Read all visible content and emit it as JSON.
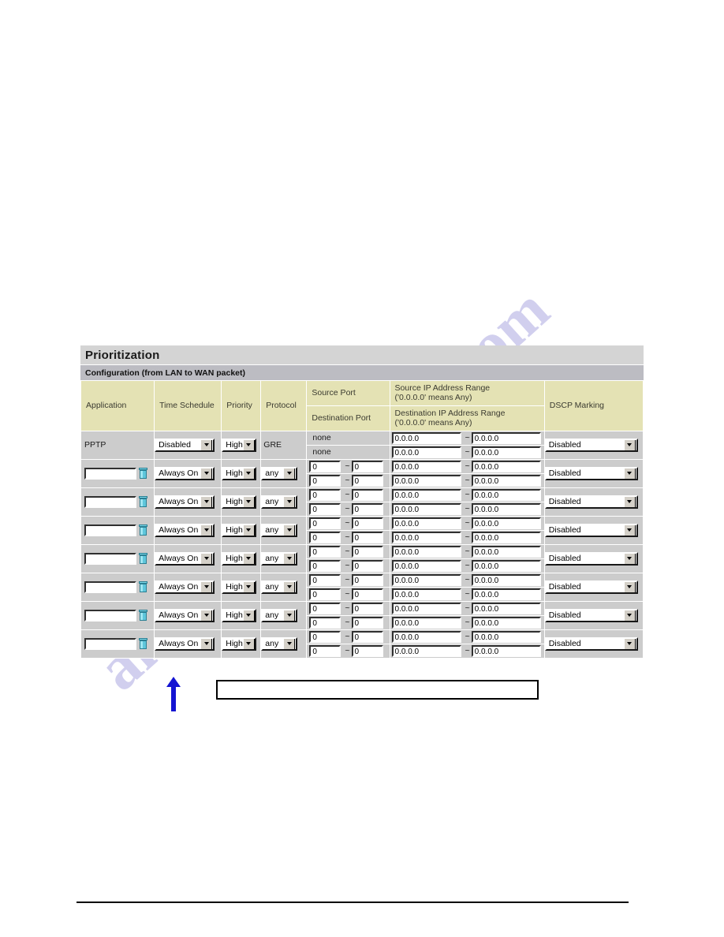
{
  "panel": {
    "title": "Prioritization",
    "subtitle": "Configuration (from LAN to WAN packet)"
  },
  "columns": {
    "application": "Application",
    "time_schedule": "Time Schedule",
    "priority": "Priority",
    "protocol": "Protocol",
    "source_port": "Source Port",
    "destination_port": "Destination Port",
    "source_ip_range_l1": "Source IP Address Range",
    "source_ip_range_l2": "('0.0.0.0' means Any)",
    "dest_ip_range_l1": "Destination IP Address Range",
    "dest_ip_range_l2": "('0.0.0.0' means Any)",
    "dscp_marking": "DSCP Marking"
  },
  "tilde": "~",
  "icons": {
    "delete": "trash-icon",
    "dropdown": "chevron-down-icon",
    "annotation_arrow": "up-arrow-annotation"
  },
  "rows": [
    {
      "application": "PPTP",
      "application_is_input": false,
      "time_schedule": "Disabled",
      "priority": "High",
      "protocol": "GRE",
      "protocol_is_select": false,
      "source_port": "none",
      "source_port_is_input": false,
      "destination_port": "none",
      "destination_port_is_input": false,
      "source_ip_start": "0.0.0.0",
      "source_ip_end": "0.0.0.0",
      "dest_ip_start": "0.0.0.0",
      "dest_ip_end": "0.0.0.0",
      "dscp_marking": "Disabled"
    },
    {
      "application": "",
      "application_is_input": true,
      "time_schedule": "Always On",
      "priority": "High",
      "protocol": "any",
      "protocol_is_select": true,
      "source_port": "0",
      "source_port_end": "0",
      "source_port_is_input": true,
      "destination_port": "0",
      "destination_port_end": "0",
      "destination_port_is_input": true,
      "source_ip_start": "0.0.0.0",
      "source_ip_end": "0.0.0.0",
      "dest_ip_start": "0.0.0.0",
      "dest_ip_end": "0.0.0.0",
      "dscp_marking": "Disabled"
    },
    {
      "application": "",
      "application_is_input": true,
      "time_schedule": "Always On",
      "priority": "High",
      "protocol": "any",
      "protocol_is_select": true,
      "source_port": "0",
      "source_port_end": "0",
      "source_port_is_input": true,
      "destination_port": "0",
      "destination_port_end": "0",
      "destination_port_is_input": true,
      "source_ip_start": "0.0.0.0",
      "source_ip_end": "0.0.0.0",
      "dest_ip_start": "0.0.0.0",
      "dest_ip_end": "0.0.0.0",
      "dscp_marking": "Disabled"
    },
    {
      "application": "",
      "application_is_input": true,
      "time_schedule": "Always On",
      "priority": "High",
      "protocol": "any",
      "protocol_is_select": true,
      "source_port": "0",
      "source_port_end": "0",
      "source_port_is_input": true,
      "destination_port": "0",
      "destination_port_end": "0",
      "destination_port_is_input": true,
      "source_ip_start": "0.0.0.0",
      "source_ip_end": "0.0.0.0",
      "dest_ip_start": "0.0.0.0",
      "dest_ip_end": "0.0.0.0",
      "dscp_marking": "Disabled"
    },
    {
      "application": "",
      "application_is_input": true,
      "time_schedule": "Always On",
      "priority": "High",
      "protocol": "any",
      "protocol_is_select": true,
      "source_port": "0",
      "source_port_end": "0",
      "source_port_is_input": true,
      "destination_port": "0",
      "destination_port_end": "0",
      "destination_port_is_input": true,
      "source_ip_start": "0.0.0.0",
      "source_ip_end": "0.0.0.0",
      "dest_ip_start": "0.0.0.0",
      "dest_ip_end": "0.0.0.0",
      "dscp_marking": "Disabled"
    },
    {
      "application": "",
      "application_is_input": true,
      "time_schedule": "Always On",
      "priority": "High",
      "protocol": "any",
      "protocol_is_select": true,
      "source_port": "0",
      "source_port_end": "0",
      "source_port_is_input": true,
      "destination_port": "0",
      "destination_port_end": "0",
      "destination_port_is_input": true,
      "source_ip_start": "0.0.0.0",
      "source_ip_end": "0.0.0.0",
      "dest_ip_start": "0.0.0.0",
      "dest_ip_end": "0.0.0.0",
      "dscp_marking": "Disabled"
    },
    {
      "application": "",
      "application_is_input": true,
      "time_schedule": "Always On",
      "priority": "High",
      "protocol": "any",
      "protocol_is_select": true,
      "source_port": "0",
      "source_port_end": "0",
      "source_port_is_input": true,
      "destination_port": "0",
      "destination_port_end": "0",
      "destination_port_is_input": true,
      "source_ip_start": "0.0.0.0",
      "source_ip_end": "0.0.0.0",
      "dest_ip_start": "0.0.0.0",
      "dest_ip_end": "0.0.0.0",
      "dscp_marking": "Disabled"
    },
    {
      "application": "",
      "application_is_input": true,
      "time_schedule": "Always On",
      "priority": "High",
      "protocol": "any",
      "protocol_is_select": true,
      "source_port": "0",
      "source_port_end": "0",
      "source_port_is_input": true,
      "destination_port": "0",
      "destination_port_end": "0",
      "destination_port_is_input": true,
      "source_ip_start": "0.0.0.0",
      "source_ip_end": "0.0.0.0",
      "dest_ip_start": "0.0.0.0",
      "dest_ip_end": "0.0.0.0",
      "dscp_marking": "Disabled"
    }
  ],
  "annotation": {
    "callout_text": ""
  },
  "watermark": {
    "text_right": ".com",
    "text_left": "anuals"
  },
  "colors": {
    "header_bg": "#e4e2b4",
    "title_bg": "#d4d4d4",
    "subtitle_bg": "#bcbcc2",
    "row_bg": "#cccccc",
    "annotation": "#1414d2",
    "watermark": "#c9c7ec"
  }
}
